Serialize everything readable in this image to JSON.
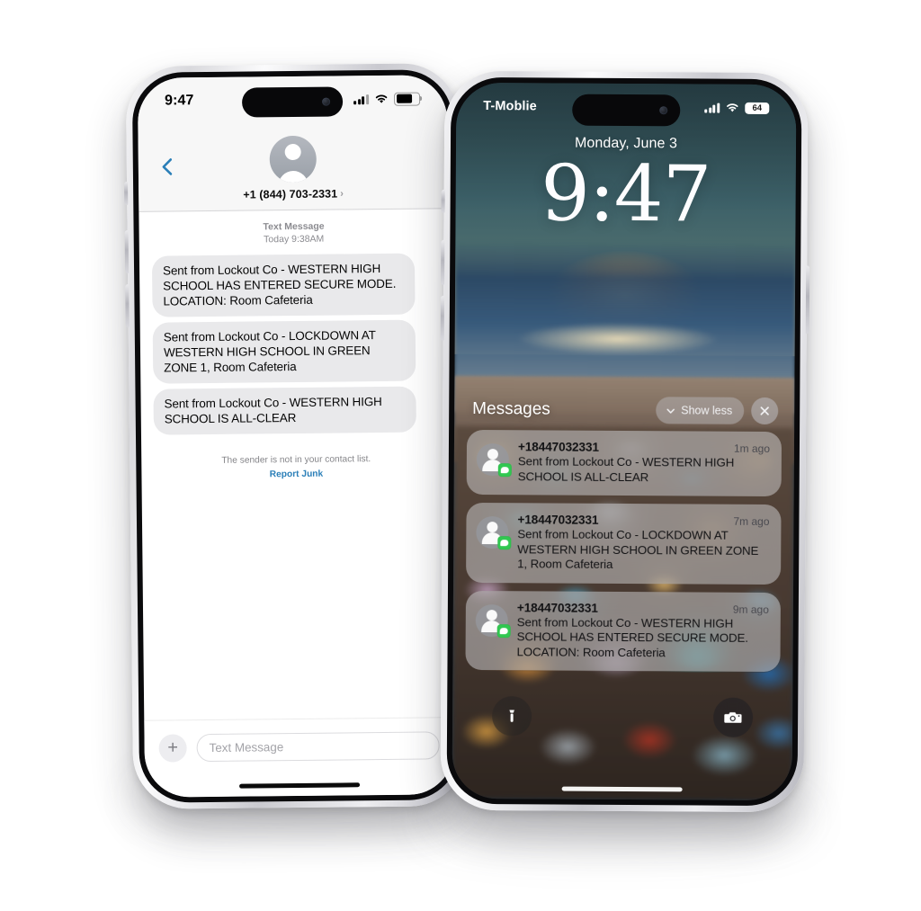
{
  "scene": {
    "background_color": "#ffffff",
    "device_count": 2
  },
  "left_phone": {
    "device_name": "iphone-messages-conversation",
    "status_bar": {
      "time": "9:47",
      "signal_icon": "cellular-bars-icon",
      "wifi_icon": "wifi-icon",
      "battery_icon": "battery-icon"
    },
    "header": {
      "back_icon": "back-chevron-icon",
      "avatar_icon": "contact-avatar-icon",
      "contact_name": "+1 (844) 703-2331",
      "disclosure_icon": "chevron-right-icon"
    },
    "thread": {
      "service_label": "Text Message",
      "timestamp": "Today 9:38AM",
      "messages": [
        {
          "text": "Sent from Lockout Co - WESTERN HIGH SCHOOL HAS ENTERED SECURE MODE. LOCATION: Room Cafeteria",
          "side": "incoming"
        },
        {
          "text": "Sent from Lockout Co - LOCKDOWN AT WESTERN HIGH SCHOOL IN GREEN ZONE 1, Room Cafeteria",
          "side": "incoming"
        },
        {
          "text": "Sent from Lockout Co - WESTERN HIGH SCHOOL IS ALL-CLEAR",
          "side": "incoming"
        }
      ],
      "junk_note": "The sender is not in your contact list.",
      "junk_link": "Report Junk",
      "link_color": "#2b7fb8",
      "bubble_color": "#e9e9eb"
    },
    "composer": {
      "add_icon": "plus-icon",
      "placeholder": "Text Message"
    }
  },
  "right_phone": {
    "device_name": "iphone-lock-screen",
    "status_bar": {
      "carrier": "T-Moblie",
      "signal_icon": "cellular-bars-icon",
      "wifi_icon": "wifi-icon",
      "battery_percent": "64"
    },
    "lock_screen": {
      "date": "Monday, June 3",
      "time": "9:47"
    },
    "notification_group": {
      "title": "Messages",
      "show_less_label": "Show less",
      "show_less_icon": "chevron-down-icon",
      "close_icon": "close-x-icon",
      "notifications": [
        {
          "sender": "+18447032331",
          "time": "1m ago",
          "text": "Sent from Lockout Co - WESTERN HIGH SCHOOL IS ALL-CLEAR",
          "avatar_icon": "contact-avatar-icon",
          "app_badge_icon": "messages-app-badge-icon",
          "badge_color": "#31c851"
        },
        {
          "sender": "+18447032331",
          "time": "7m ago",
          "text": "Sent from Lockout Co - LOCKDOWN AT WESTERN HIGH SCHOOL IN GREEN ZONE 1, Room Cafeteria",
          "avatar_icon": "contact-avatar-icon",
          "app_badge_icon": "messages-app-badge-icon",
          "badge_color": "#31c851"
        },
        {
          "sender": "+18447032331",
          "time": "9m ago",
          "text": "Sent from Lockout Co - WESTERN HIGH SCHOOL HAS ENTERED SECURE MODE. LOCATION: Room Cafeteria",
          "avatar_icon": "contact-avatar-icon",
          "app_badge_icon": "messages-app-badge-icon",
          "badge_color": "#31c851"
        }
      ]
    },
    "bottom_controls": {
      "flashlight_icon": "flashlight-icon",
      "camera_icon": "camera-icon"
    }
  }
}
